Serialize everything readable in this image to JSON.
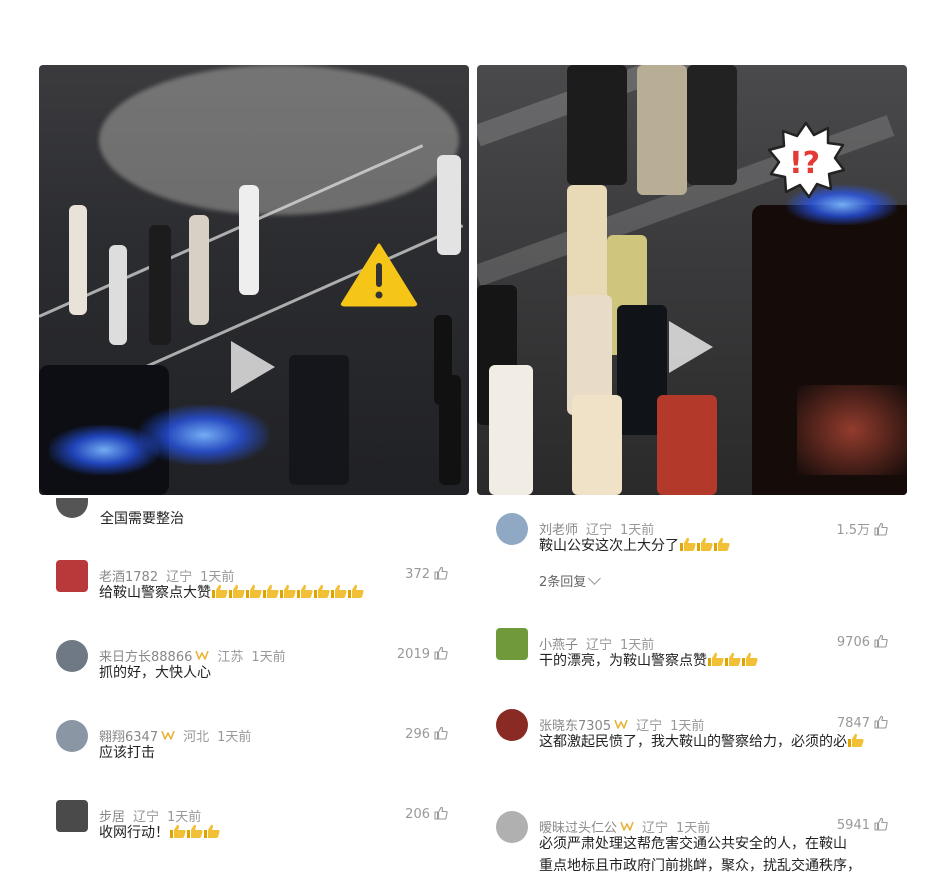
{
  "left_column": {
    "partial_top_comment": "全国需要整治",
    "comments": [
      {
        "user": "老酒1782",
        "location": "辽宁",
        "time": "1天前",
        "likes": "372",
        "text": "给鞍山警察点大赞",
        "thumbs": 9,
        "vip": false
      },
      {
        "user": "来日方长88866",
        "location": "江苏",
        "time": "1天前",
        "likes": "2019",
        "text": "抓的好，大快人心",
        "thumbs": 0,
        "vip": true
      },
      {
        "user": "翱翔6347",
        "location": "河北",
        "time": "1天前",
        "likes": "296",
        "text": "应该打击",
        "thumbs": 0,
        "vip": true
      },
      {
        "user": "步居",
        "location": "辽宁",
        "time": "1天前",
        "likes": "206",
        "text": "收网行动！",
        "thumbs": 3,
        "vip": false
      }
    ]
  },
  "right_column": {
    "comments": [
      {
        "user": "刘老师",
        "location": "辽宁",
        "time": "1天前",
        "likes": "1.5万",
        "text": "鞍山公安这次上大分了",
        "thumbs": 3,
        "vip": false,
        "replies": "2条回复"
      },
      {
        "user": "小燕子",
        "location": "辽宁",
        "time": "1天前",
        "likes": "9706",
        "text": "干的漂亮，为鞍山警察点赞",
        "thumbs": 3,
        "vip": false
      },
      {
        "user": "张晓东7305",
        "location": "辽宁",
        "time": "1天前",
        "likes": "7847",
        "text": "这都激起民愤了，我大鞍山的警察给力，必须的必",
        "thumbs": 1,
        "vip": true
      },
      {
        "user": "暧昧过头仁公",
        "location": "辽宁",
        "time": "1天前",
        "likes": "5941",
        "text_lines": [
          "必须严肃处理这帮危害交通公共安全的人，在鞍山",
          "重点地标且市政府门前挑衅，聚众，扰乱交通秩序，"
        ],
        "vip": true
      }
    ]
  },
  "colors": {
    "text": "#222222",
    "meta": "#999999",
    "thumb": "#f2c037",
    "background": "#ffffff"
  }
}
